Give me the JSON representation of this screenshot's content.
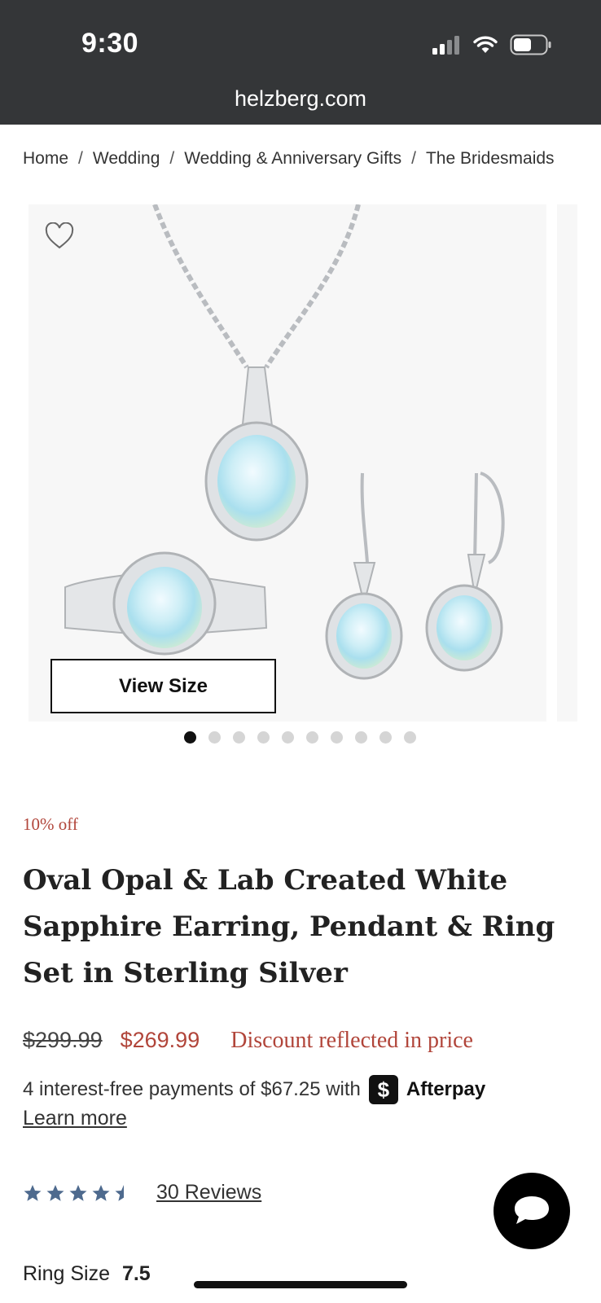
{
  "status_bar": {
    "time": "9:30",
    "url": "helzberg.com"
  },
  "breadcrumb": [
    "Home",
    "Wedding",
    "Wedding & Anniversary Gifts",
    "The Bridesmaids"
  ],
  "gallery": {
    "view_size_label": "View Size",
    "slide_count": 10,
    "active_slide": 1
  },
  "product": {
    "discount_tag": "10% off",
    "title": "Oval Opal & Lab Created White Sapphire Earring, Pendant & Ring Set in Sterling Silver",
    "original_price": "$299.99",
    "sale_price": "$269.99",
    "price_note": "Discount reflected in price",
    "afterpay_text": "4 interest-free payments of $67.25 with",
    "afterpay_brand": "Afterpay",
    "afterpay_badge": "$",
    "learn_more": "Learn more",
    "rating": 4.5,
    "reviews_label": "30 Reviews",
    "ring_size_label": "Ring Size",
    "ring_size_value": "7.5"
  },
  "colors": {
    "header_bg": "#343638",
    "sale_red": "#b1453a",
    "star_blue": "#4e6a8e"
  }
}
